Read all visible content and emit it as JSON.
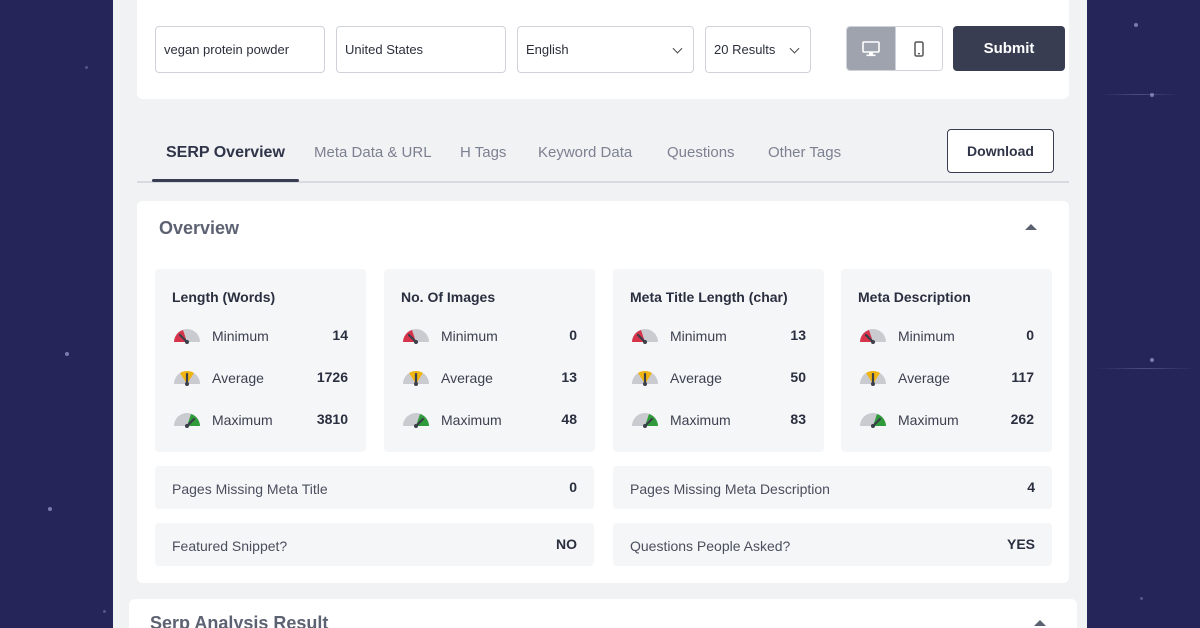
{
  "search": {
    "keyword": "vegan protein powder",
    "country": "United States",
    "language": "English",
    "results": "20 Results",
    "submit_label": "Submit"
  },
  "tabs": [
    {
      "label": "SERP Overview",
      "active": true
    },
    {
      "label": "Meta Data & URL"
    },
    {
      "label": "H Tags"
    },
    {
      "label": "Keyword Data"
    },
    {
      "label": "Questions"
    },
    {
      "label": "Other Tags"
    }
  ],
  "download_label": "Download",
  "overview": {
    "title": "Overview",
    "row_labels": {
      "min": "Minimum",
      "avg": "Average",
      "max": "Maximum"
    },
    "stats": [
      {
        "title": "Length (Words)",
        "min": "14",
        "avg": "1726",
        "max": "3810"
      },
      {
        "title": "No. Of Images",
        "min": "0",
        "avg": "13",
        "max": "48"
      },
      {
        "title": "Meta Title Length (char)",
        "min": "13",
        "avg": "50",
        "max": "83"
      },
      {
        "title": "Meta Description",
        "min": "0",
        "avg": "117",
        "max": "262"
      }
    ],
    "info": [
      {
        "label": "Pages Missing Meta Title",
        "value": "0"
      },
      {
        "label": "Pages Missing Meta Description",
        "value": "4"
      },
      {
        "label": "Featured Snippet?",
        "value": "NO"
      },
      {
        "label": "Questions People Asked?",
        "value": "YES"
      }
    ]
  },
  "serp_analysis": {
    "title": "Serp Analysis Result"
  },
  "colors": {
    "gauge_min": "#d7334b",
    "gauge_avg": "#f1b512",
    "gauge_max": "#2f9b3a",
    "primary": "#393d52"
  }
}
